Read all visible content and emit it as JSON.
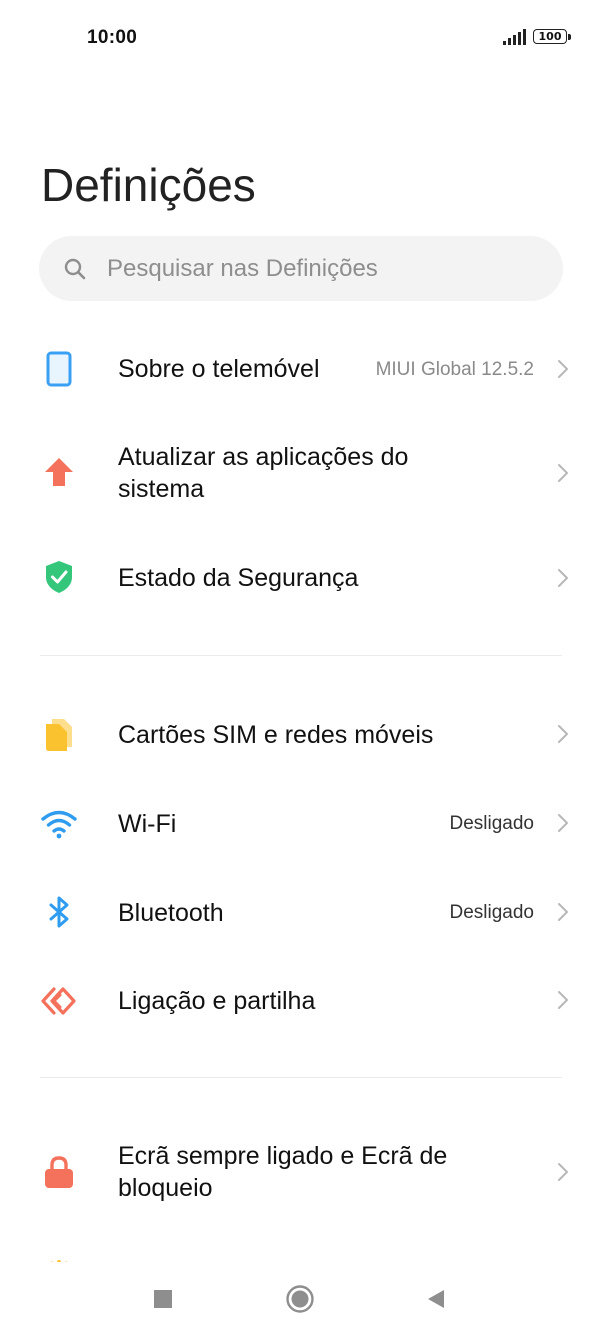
{
  "status_bar": {
    "time": "10:00",
    "battery_level": "100",
    "signal_icon": "signal-bars-icon",
    "battery_icon": "battery-icon"
  },
  "page": {
    "title": "Definições"
  },
  "search": {
    "placeholder": "Pesquisar nas Definições",
    "value": ""
  },
  "groups": [
    [
      {
        "id": "about",
        "label": "Sobre o telemóvel",
        "value": "MIUI Global 12.5.2",
        "icon": "phone-icon",
        "icon_color": "#3aa0f3"
      },
      {
        "id": "update",
        "label": "Atualizar as aplicações do sistema",
        "value": "",
        "icon": "arrow-up-icon",
        "icon_color": "#f4715c"
      },
      {
        "id": "security",
        "label": "Estado da Segurança",
        "value": "",
        "icon": "shield-check-icon",
        "icon_color": "#34c77b"
      }
    ],
    [
      {
        "id": "sim",
        "label": "Cartões SIM e redes móveis",
        "value": "",
        "icon": "sim-card-icon",
        "icon_color": "#f9c22e"
      },
      {
        "id": "wifi",
        "label": "Wi-Fi",
        "value": "Desligado",
        "icon": "wifi-icon",
        "icon_color": "#2f9cf0"
      },
      {
        "id": "bluetooth",
        "label": "Bluetooth",
        "value": "Desligado",
        "icon": "bluetooth-icon",
        "icon_color": "#2f9cf0"
      },
      {
        "id": "sharing",
        "label": "Ligação e partilha",
        "value": "",
        "icon": "connection-sharing-icon",
        "icon_color": "#f4715c"
      }
    ],
    [
      {
        "id": "lockscreen",
        "label": "Ecrã sempre ligado e Ecrã de bloqueio",
        "value": "",
        "icon": "lock-icon",
        "icon_color": "#f4715c"
      }
    ]
  ],
  "nav_bar": {
    "recent_icon": "square-icon",
    "home_icon": "circle-icon",
    "back_icon": "triangle-back-icon"
  }
}
